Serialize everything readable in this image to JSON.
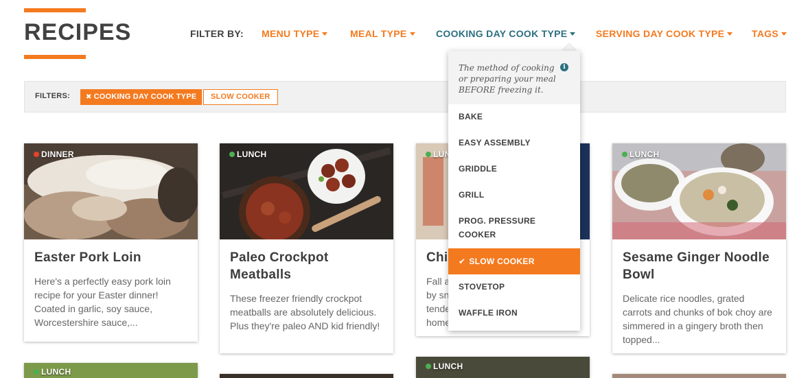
{
  "header": {
    "title": "RECIPES",
    "filter_by_label": "FILTER BY:",
    "nav": [
      {
        "label": "MENU TYPE"
      },
      {
        "label": "MEAL TYPE"
      },
      {
        "label": "COOKING DAY COOK TYPE",
        "active": true
      },
      {
        "label": "SERVING DAY COOK TYPE"
      },
      {
        "label": "TAGS"
      }
    ]
  },
  "filters": {
    "label": "FILTERS:",
    "active_filter": {
      "name": "COOKING DAY COOK TYPE",
      "value": "SLOW COOKER"
    }
  },
  "dropdown": {
    "info": "The method of cooking or preparing your meal BEFORE freezing it.",
    "items": [
      {
        "label": "BAKE"
      },
      {
        "label": "EASY ASSEMBLY"
      },
      {
        "label": "GRIDDLE"
      },
      {
        "label": "GRILL"
      },
      {
        "label": "PROG. PRESSURE",
        "label2": "COOKER"
      },
      {
        "label": "SLOW COOKER",
        "selected": true
      },
      {
        "label": "STOVETOP"
      },
      {
        "label": "WAFFLE IRON"
      }
    ]
  },
  "cards": [
    {
      "badge": "DINNER",
      "badge_color": "#e2432a",
      "title": "Easter Pork Loin",
      "desc": "Here's a perfectly easy pork loin recipe for your Easter dinner! Coated in garlic, soy sauce, Worcestershire sauce,..."
    },
    {
      "badge": "LUNCH",
      "badge_color": "#4caf50",
      "title": "Paleo Crockpot Meatballs",
      "desc": "These freezer friendly crockpot meatballs are absolutely delicious. Plus they're paleo AND kid friendly!"
    },
    {
      "badge": "LUNCH",
      "badge_color": "#4caf50",
      "title": "Chi",
      "desc_lines": [
        "Fall a",
        "by sn",
        "tende",
        "home"
      ]
    },
    {
      "badge": "LUNCH",
      "badge_color": "#4caf50",
      "title": "Sesame Ginger Noodle Bowl",
      "desc": "Delicate rice noodles, grated carrots and chunks of bok choy are simmered in a gingery broth then topped..."
    },
    {
      "badge": "LUNCH",
      "badge_color": "#4caf50"
    },
    {
      "badge": "LUNCH",
      "badge_color": "#4caf50"
    }
  ],
  "colors": {
    "accent": "#f47a1f",
    "active_nav": "#2b6f7f"
  }
}
